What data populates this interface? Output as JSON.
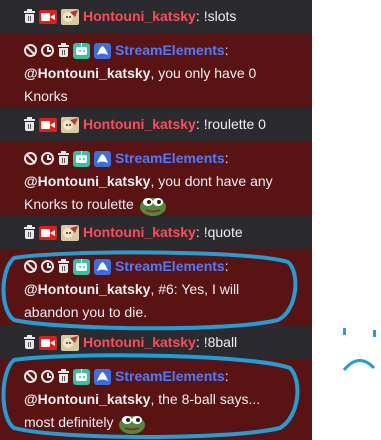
{
  "colors": {
    "user_bg": "#2b2b2f",
    "bot_bg": "#5a1313",
    "username": "#ff4a5a",
    "botname": "#4d7cff",
    "annotation": "#1e9fd6"
  },
  "messages": [
    {
      "kind": "user",
      "name": "Hontouni_katsky",
      "sep": ":",
      "text": "!slots"
    },
    {
      "kind": "bot",
      "name": "StreamElements",
      "sep": ":",
      "mention": "@Hontouni_katsky",
      "line1_rest": ", you only have 0",
      "line2": "Knorks",
      "emote": false
    },
    {
      "kind": "user",
      "name": "Hontouni_katsky",
      "sep": ":",
      "text": "!roulette 0"
    },
    {
      "kind": "bot",
      "name": "StreamElements",
      "sep": ":",
      "mention": "@Hontouni_katsky",
      "line1_rest": ", you dont have any",
      "line2": "Knorks to roulette",
      "emote": true
    },
    {
      "kind": "user",
      "name": "Hontouni_katsky",
      "sep": ":",
      "text": "!quote"
    },
    {
      "kind": "bot",
      "name": "StreamElements",
      "sep": ":",
      "mention": "@Hontouni_katsky",
      "line1_rest": ", #6: Yes, I will",
      "line2": "abandon you to die.",
      "emote": false
    },
    {
      "kind": "user",
      "name": "Hontouni_katsky",
      "sep": ":",
      "text": "!8ball"
    },
    {
      "kind": "bot",
      "name": "StreamElements",
      "sep": ":",
      "mention": "@Hontouni_katsky",
      "line1_rest": ", the 8-ball says...",
      "line2": "most definitely",
      "emote": true
    }
  ],
  "icons": {
    "trash": "trash-icon",
    "ban": "ban-icon",
    "timeout": "timeout-icon",
    "broadcaster": "broadcaster-icon",
    "avatar": "avatar-icon",
    "robot": "robot-icon",
    "verified": "verified-icon",
    "emote": "pepe-emote-icon",
    "sad_face": "sad-face-icon"
  }
}
